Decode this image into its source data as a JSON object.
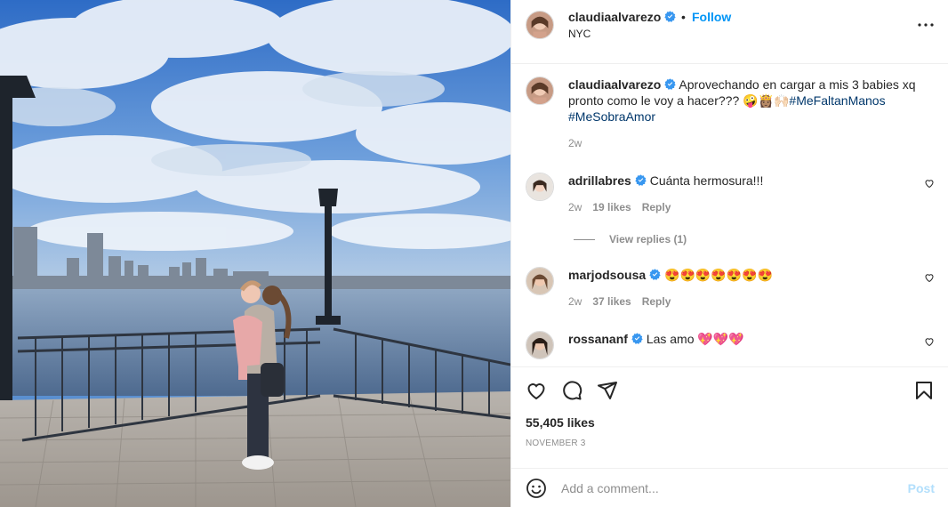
{
  "post": {
    "username": "claudiaalvarezo",
    "follow_label": "Follow",
    "separator": "•",
    "location": "NYC",
    "caption_username": "claudiaalvarezo",
    "caption_text": "Aprovechando en cargar a mis 3 babies xq pronto como le voy a hacer??? 🤪👸🏽🙌🏻",
    "caption_tag1": "#MeFaltanManos",
    "caption_tag2": "#MeSobraAmor",
    "caption_time": "2w",
    "likes": "55,405 likes",
    "date": "NOVEMBER 3"
  },
  "comments": [
    {
      "username": "adrillabres",
      "text": "Cuánta hermosura!!!",
      "time": "2w",
      "likes": "19 likes",
      "reply": "Reply"
    },
    {
      "username": "marjodsousa",
      "text": "😍😍😍😍😍😍😍",
      "time": "2w",
      "likes": "37 likes",
      "reply": "Reply"
    },
    {
      "username": "rossananf",
      "text": "Las amo 💖💖💖"
    }
  ],
  "view_replies": "View replies (1)",
  "add_comment": {
    "placeholder": "Add a comment...",
    "post_label": "Post"
  },
  "icons": {
    "more": "more-options-icon",
    "like": "heart-icon",
    "comment": "comment-icon",
    "share": "share-icon",
    "save": "bookmark-icon",
    "emoji": "emoji-icon",
    "verified": "verified-badge-icon"
  },
  "colors": {
    "accent": "#0095f6",
    "post_disabled": "#b2dffc",
    "hashtag": "#00376b",
    "muted": "#8e8e8e"
  }
}
